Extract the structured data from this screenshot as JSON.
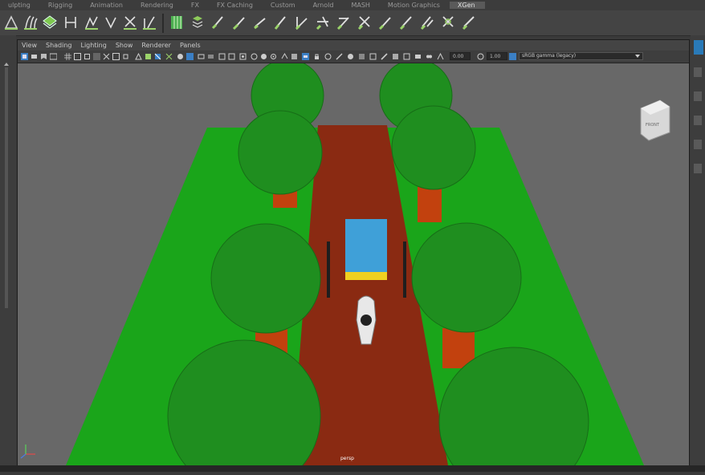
{
  "shelf": {
    "tabs": [
      "ulpting",
      "Rigging",
      "Animation",
      "Rendering",
      "FX",
      "FX Caching",
      "Custom",
      "Arnold",
      "MASH",
      "Motion Graphics",
      "XGen"
    ],
    "active_tab": "XGen"
  },
  "panel": {
    "menu": [
      "View",
      "Shading",
      "Lighting",
      "Show",
      "Renderer",
      "Panels"
    ],
    "toolbar": {
      "field_1": "0.00",
      "field_2": "1.00",
      "color_space": "sRGB gamma (legacy)"
    },
    "camera_label": "persp"
  },
  "scene": {
    "colors": {
      "background": "#686868",
      "grass": "#1aa51a",
      "road": "#8a2a12",
      "trunk": "#c2410e",
      "foliage": "#1f8e1f",
      "box_top": "#3fa0d8",
      "box_band": "#f0d020"
    }
  }
}
